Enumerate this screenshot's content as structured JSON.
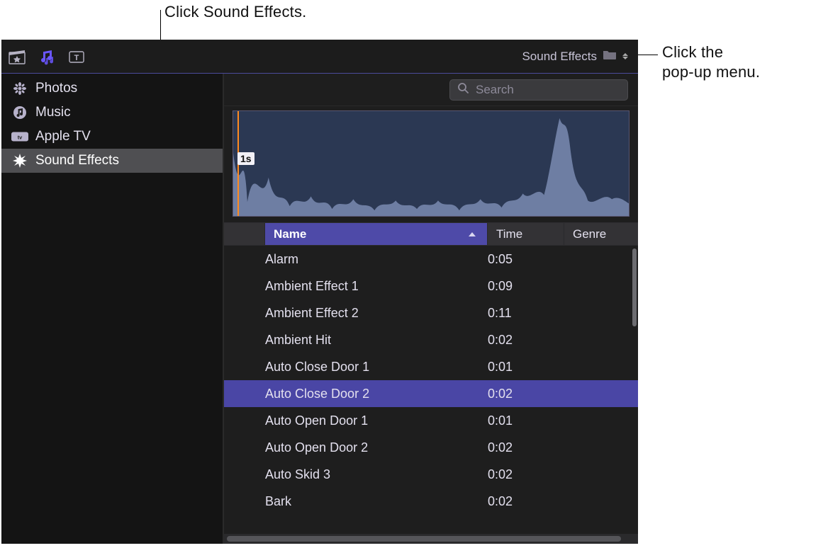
{
  "callouts": {
    "top": "Click Sound Effects.",
    "right_line1": "Click the",
    "right_line2": "pop-up menu."
  },
  "toolbar": {
    "icons": [
      "clapper-favorite-icon",
      "music-browser-icon",
      "titles-browser-icon"
    ]
  },
  "popup": {
    "label": "Sound Effects"
  },
  "search": {
    "placeholder": "Search",
    "value": ""
  },
  "sidebar": {
    "items": [
      {
        "label": "Photos",
        "icon": "flower-icon",
        "selected": false
      },
      {
        "label": "Music",
        "icon": "music-icon",
        "selected": false
      },
      {
        "label": "Apple TV",
        "icon": "appletv-icon",
        "selected": false
      },
      {
        "label": "Sound Effects",
        "icon": "burst-icon",
        "selected": true
      }
    ]
  },
  "waveform": {
    "time_badge": "1s"
  },
  "table": {
    "columns": {
      "name": "Name",
      "time": "Time",
      "genre": "Genre"
    },
    "sort_column": "name",
    "sort_dir": "asc",
    "rows": [
      {
        "name": "Alarm",
        "time": "0:05",
        "genre": "",
        "selected": false
      },
      {
        "name": "Ambient Effect 1",
        "time": "0:09",
        "genre": "",
        "selected": false
      },
      {
        "name": "Ambient Effect 2",
        "time": "0:11",
        "genre": "",
        "selected": false
      },
      {
        "name": "Ambient Hit",
        "time": "0:02",
        "genre": "",
        "selected": false
      },
      {
        "name": "Auto Close Door 1",
        "time": "0:01",
        "genre": "",
        "selected": false
      },
      {
        "name": "Auto Close Door 2",
        "time": "0:02",
        "genre": "",
        "selected": true
      },
      {
        "name": "Auto Open Door 1",
        "time": "0:01",
        "genre": "",
        "selected": false
      },
      {
        "name": "Auto Open Door 2",
        "time": "0:02",
        "genre": "",
        "selected": false
      },
      {
        "name": "Auto Skid 3",
        "time": "0:02",
        "genre": "",
        "selected": false
      },
      {
        "name": "Bark",
        "time": "0:02",
        "genre": "",
        "selected": false
      }
    ]
  }
}
